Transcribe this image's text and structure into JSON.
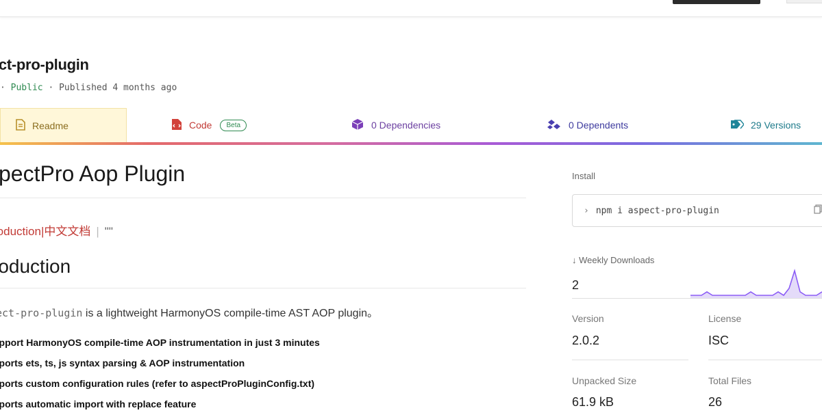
{
  "header": {
    "package_title": "ect-pro-plugin",
    "meta_prefix": "· ",
    "visibility": "Public",
    "published": " · Published 4 months ago"
  },
  "tabs": [
    {
      "label": "Readme",
      "icon": "readme-icon"
    },
    {
      "label": "Code",
      "badge": "Beta",
      "icon": "code-icon"
    },
    {
      "label": "0 Dependencies",
      "icon": "dependencies-icon"
    },
    {
      "label": "0 Dependents",
      "icon": "dependents-icon"
    },
    {
      "label": "29 Versions",
      "icon": "versions-icon"
    }
  ],
  "readme": {
    "h1": "spectPro Aop Plugin",
    "lang_link_en": "roduction",
    "lang_link_sep": "|",
    "lang_link_zh": "中文文档",
    "lang_link_sep2": "|",
    "lang_link_extra": "\"\"",
    "h2": "roduction",
    "intro_code": "ect-pro-plugin",
    "intro_text": " is a lightweight HarmonyOS compile-time AST AOP plugin。",
    "features": [
      "upport HarmonyOS compile-time AOP instrumentation in just 3 minutes",
      "pports ets, ts, js syntax parsing & AOP instrumentation",
      "pports custom configuration rules (refer to aspectProPluginConfig.txt)",
      "pports automatic import with replace feature"
    ]
  },
  "sidebar": {
    "install_label": "Install",
    "install_prompt": "›",
    "install_command": "npm i aspect-pro-plugin",
    "downloads_label": "↓ Weekly Downloads",
    "downloads_value": "2",
    "sparkline": [
      0,
      0,
      0,
      1,
      0,
      0,
      0,
      0,
      0,
      0,
      0,
      1,
      0,
      0,
      0,
      0,
      1,
      0,
      2,
      7,
      1,
      0,
      0,
      0,
      1
    ],
    "version_label": "Version",
    "version_value": "2.0.2",
    "license_label": "License",
    "license_value": "ISC",
    "unpacked_label": "Unpacked Size",
    "unpacked_value": "61.9 kB",
    "files_label": "Total Files",
    "files_value": "26"
  },
  "colors": {
    "sparkline_stroke": "#8b5cf6",
    "sparkline_fill": "#d9ccf7"
  }
}
